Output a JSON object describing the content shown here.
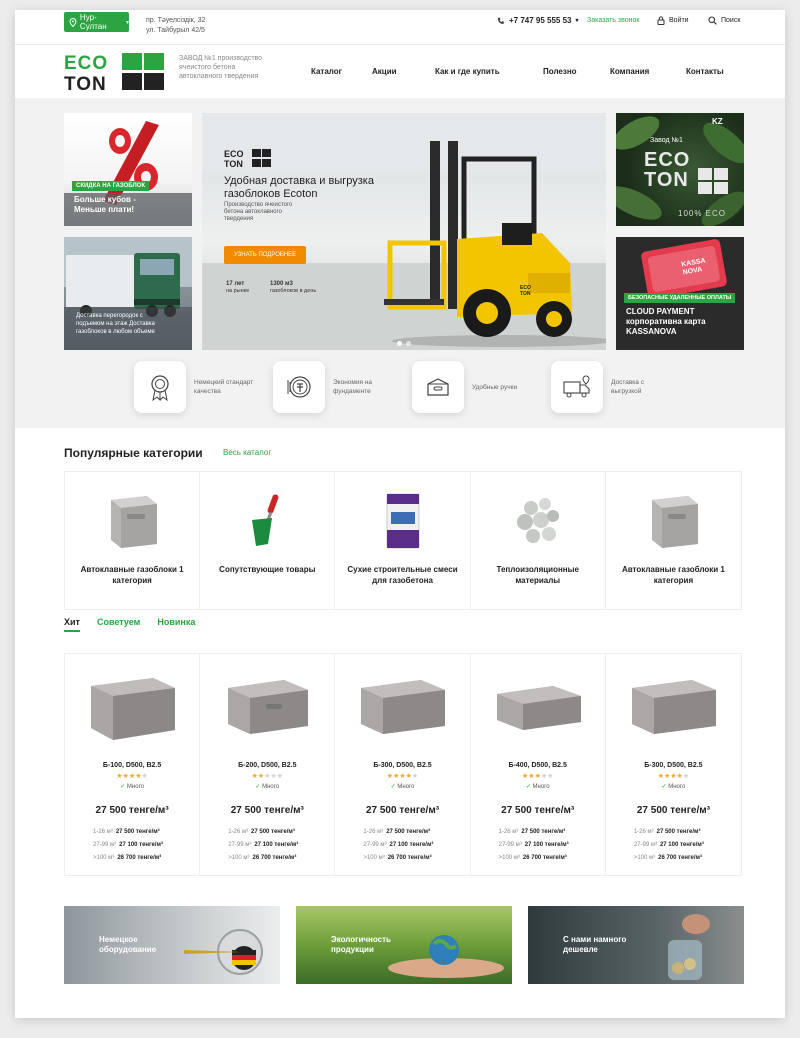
{
  "topbar": {
    "city": "Нур-Султан",
    "address_line1": "пр. Тәуелсіздік, 32",
    "address_line2": "ул. Тайбурыл 42/5",
    "phone": "+7 747 95 555 53",
    "callback": "Заказать звонок",
    "login": "Войти",
    "search": "Поиск"
  },
  "header": {
    "logo_line1": "ECO",
    "logo_line2": "TON",
    "tagline": "ЗАВОД №1 производство ячеистого бетона автоклавного твердения",
    "nav": [
      "Каталог",
      "Акции",
      "Как и где купить",
      "Полезно",
      "Компания",
      "Контакты"
    ]
  },
  "tiles": {
    "left1": {
      "badge": "СКИДКА НА ГАЗОБЛОК",
      "title_line1": "Больше кубов -",
      "title_line2": "Меньше плати!"
    },
    "left2": {
      "text": "Доставка перегородок с подъемом на этаж Доставка газоблоков в любом объеме"
    },
    "right1": {
      "top": "Завод №1",
      "brand1": "ECO",
      "brand2": "TON",
      "eco": "100% ECO",
      "kz": "KZ"
    },
    "right2": {
      "badge": "БЕЗОПАСНЫЕ УДАЛЕННЫЕ ОПЛАТЫ",
      "title_line1": "CLOUD PAYMENT",
      "title_line2": "корпоративна карта",
      "title_line3": "KASSANOVA",
      "card_text": "KASSA NOVA"
    }
  },
  "banner": {
    "logo1": "ECO",
    "logo2": "TON",
    "title": "Удобная доставка и выгрузка газоблоков Ecoton",
    "subtitle": "Производство ячеистого бетона автоклавного твердения",
    "button": "УЗНАТЬ ПОДРОБНЕЕ",
    "stat1_value": "17 лет",
    "stat1_label": "на рынке",
    "stat2_value": "1300 м3",
    "stat2_label": "газоблоков в день",
    "forklift_brand": "ECO TON"
  },
  "features": [
    {
      "icon": "medal-icon",
      "text": "Немецкий стандарт качества"
    },
    {
      "icon": "coin-icon",
      "text": "Экономия на фундаменте"
    },
    {
      "icon": "box-handle-icon",
      "text": "Удобные ручки"
    },
    {
      "icon": "truck-pin-icon",
      "text": "Доставка с выгрузкой"
    }
  ],
  "popular": {
    "title": "Популярные категории",
    "all_link": "Весь каталог",
    "items": [
      {
        "name": "Автоклавные газоблоки 1 категория"
      },
      {
        "name": "Сопутствующие товары"
      },
      {
        "name": "Сухие строительные смеси для газобетона"
      },
      {
        "name": "Теплоизоляционные материалы"
      },
      {
        "name": "Автоклавные газоблоки 1 категория"
      }
    ]
  },
  "tabs": [
    "Хит",
    "Советуем",
    "Новинка"
  ],
  "products": [
    {
      "name": "Б-100, D500, B2.5",
      "rating": 4,
      "stock": "Много",
      "price": "27 500 тенге/м³",
      "tiers": [
        [
          "1-26 м³",
          "27 500 тенге/м³"
        ],
        [
          "27-99 м³",
          "27 100 тенге/м³"
        ],
        [
          ">100 м³",
          "26 700 тенге/м³"
        ]
      ]
    },
    {
      "name": "Б-200, D500, B2.5",
      "rating": 2,
      "stock": "Много",
      "price": "27 500 тенге/м³",
      "tiers": [
        [
          "1-26 м³",
          "27 500 тенге/м³"
        ],
        [
          "27-99 м³",
          "27 100 тенге/м³"
        ],
        [
          ">100 м³",
          "26 700 тенге/м³"
        ]
      ]
    },
    {
      "name": "Б-300, D500, B2.5",
      "rating": 4,
      "stock": "Много",
      "price": "27 500 тенге/м³",
      "tiers": [
        [
          "1-26 м³",
          "27 500 тенге/м³"
        ],
        [
          "27-99 м³",
          "27 100 тенге/м³"
        ],
        [
          ">100 м³",
          "26 700 тенге/м³"
        ]
      ]
    },
    {
      "name": "Б-400, D500, B2.5",
      "rating": 3,
      "stock": "Много",
      "price": "27 500 тенге/м³",
      "tiers": [
        [
          "1-26 м³",
          "27 500 тенге/м³"
        ],
        [
          "27-99 м³",
          "27 100 тенге/м³"
        ],
        [
          ">100 м³",
          "26 700 тенге/м³"
        ]
      ]
    },
    {
      "name": "Б-300, D500, B2.5",
      "rating": 4,
      "stock": "Много",
      "price": "27 500 тенге/м³",
      "tiers": [
        [
          "1-26 м³",
          "27 500 тенге/м³"
        ],
        [
          "27-99 м³",
          "27 100 тенге/м³"
        ],
        [
          ">100 м³",
          "26 700 тенге/м³"
        ]
      ]
    }
  ],
  "bottom_banners": [
    {
      "line1": "Немецкое",
      "line2": "оборудование"
    },
    {
      "line1": "Экологичность",
      "line2": "продукции"
    },
    {
      "line1": "С нами намного",
      "line2": "дешевле"
    }
  ],
  "colors": {
    "accent": "#2aa542",
    "orange": "#f08a00",
    "star": "#f5a623"
  }
}
